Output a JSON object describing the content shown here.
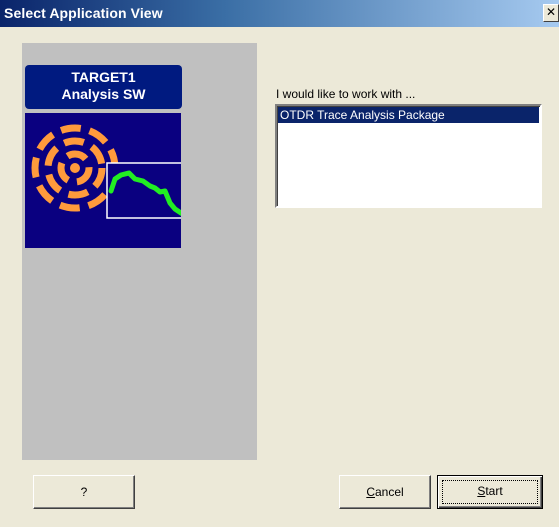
{
  "window": {
    "title": "Select Application View",
    "close_glyph": "✕"
  },
  "logo": {
    "line1": "TARGET1",
    "line2": "Analysis SW",
    "image_icon": "otdr-trace-icon",
    "colors": {
      "background": "#0a0080",
      "rings": "#ff9a3c",
      "trace": "#22ee22",
      "frame": "#ffffff"
    }
  },
  "main": {
    "prompt": "I would like to work with ...",
    "list": {
      "items": [
        {
          "label": "OTDR Trace Analysis Package",
          "selected": true
        }
      ]
    }
  },
  "buttons": {
    "help_label": "?",
    "cancel_label": "Cancel",
    "start_label": "Start"
  },
  "colors": {
    "title_gradient_start": "#0a246a",
    "selection": "#0a246a",
    "dialog_face": "#ece9d8",
    "left_panel": "#c0c0c0"
  }
}
